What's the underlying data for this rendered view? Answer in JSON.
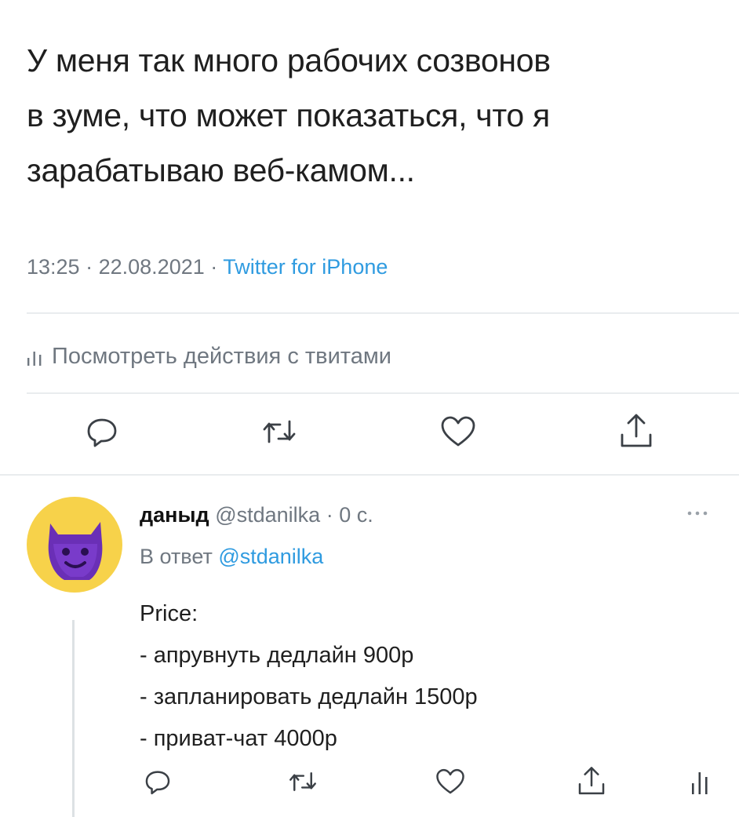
{
  "tweet": {
    "text_lines": [
      "У меня так много рабочих созвонов",
      "в зуме, что может показаться, что я",
      "зарабатываю веб-камом..."
    ],
    "time": "13:25",
    "date": "22.08.2021",
    "separator": "·",
    "source": "Twitter for iPhone",
    "activity_label": "Посмотреть действия с твитами"
  },
  "reply": {
    "display_name": "даныд",
    "handle": "@stdanilka",
    "separator": "·",
    "age": "0 с.",
    "reply_prefix": "В ответ",
    "reply_handle": "@stdanilka",
    "body_lines": [
      "Price:",
      "- апрувнуть дедлайн 900р",
      "- запланировать дедлайн 1500р",
      "- приват-чат 4000р"
    ]
  },
  "icons": {
    "reply": "reply-icon",
    "retweet": "retweet-icon",
    "like": "heart-icon",
    "share": "share-icon",
    "analytics": "analytics-icon",
    "more": "more-icon"
  },
  "colors": {
    "text": "#1f1f1f",
    "muted": "#6f7780",
    "link": "#2f9be0",
    "avatar_bg": "#f7d24a",
    "avatar_figure": "#6a2fb6"
  }
}
